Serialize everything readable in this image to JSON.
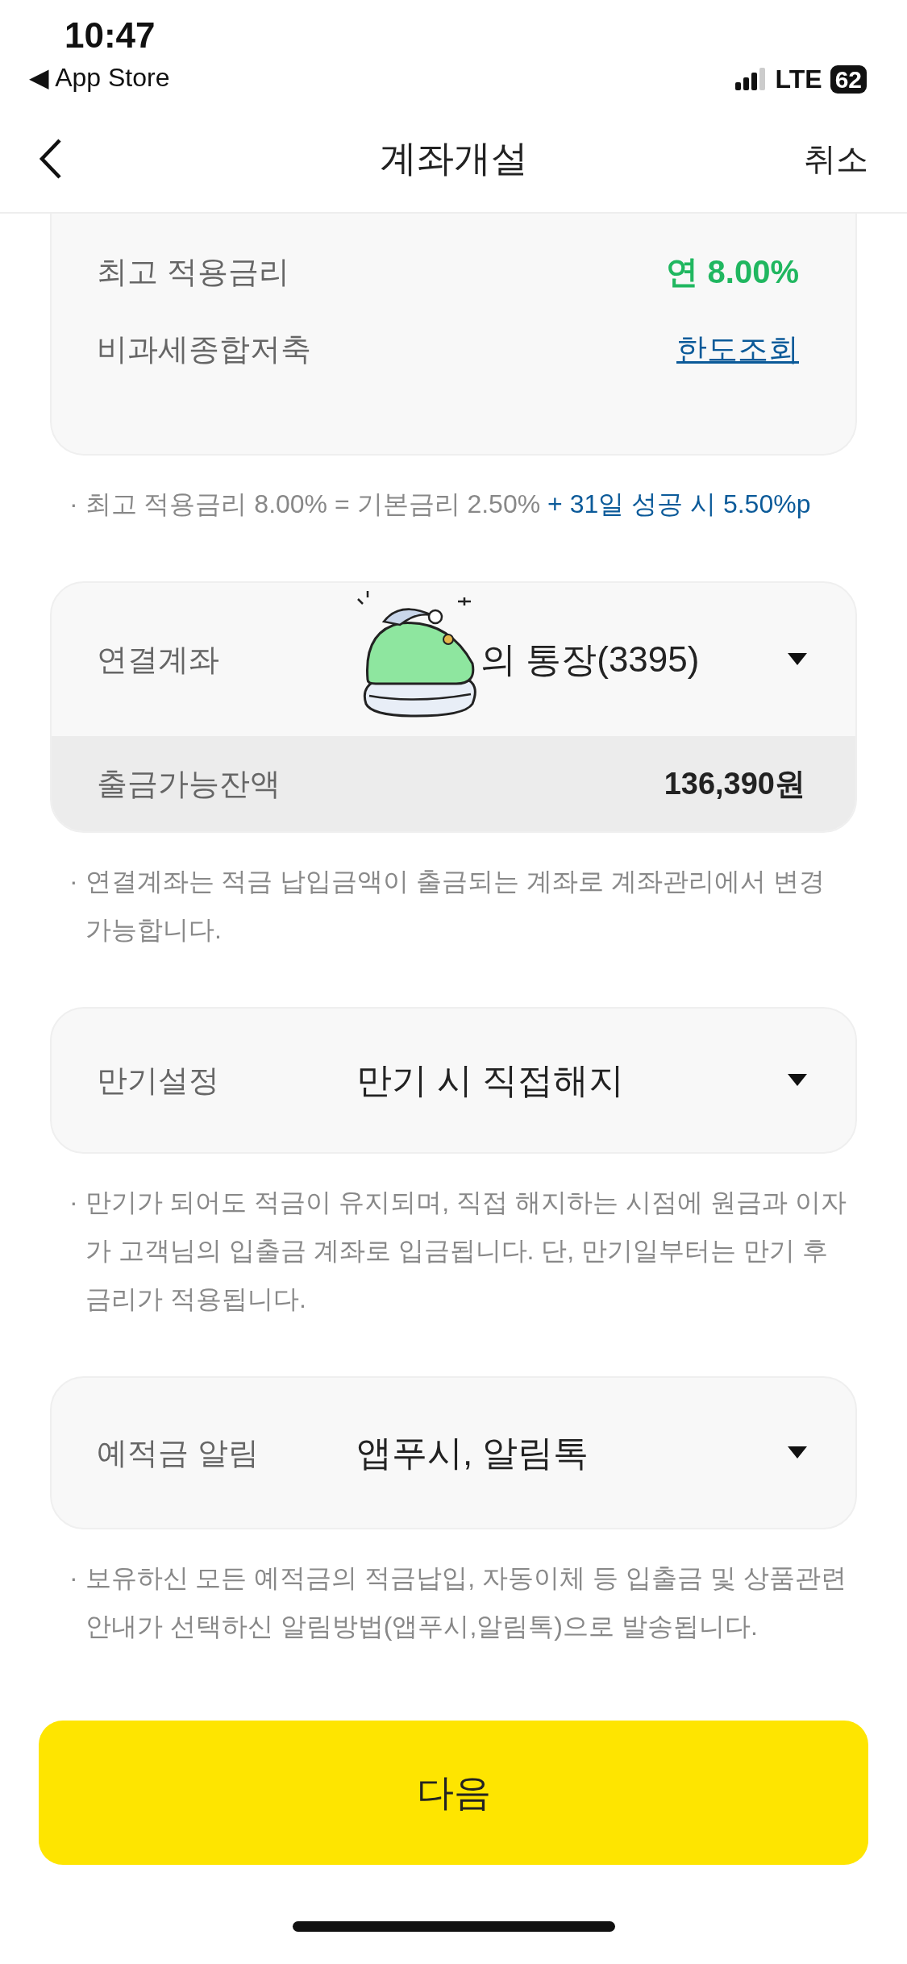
{
  "status_bar": {
    "time": "10:47",
    "back_app": "App Store",
    "back_arrow": "◀",
    "network": "LTE",
    "battery": "62"
  },
  "nav": {
    "title": "계좌개설",
    "cancel": "취소"
  },
  "rate_card": {
    "rows": [
      {
        "kind": "rate",
        "label": "최고 적용금리",
        "value": "연 8.00%"
      },
      {
        "kind": "link",
        "label": "비과세종합저축",
        "value": "한도조회"
      }
    ]
  },
  "rate_note": {
    "bullet": "·",
    "parts": [
      {
        "kind": "plain",
        "text": "최고 적용금리 8.00% = 기본금리 2.50% "
      },
      {
        "kind": "highlight",
        "text": "+ 31일 성공 시 5.50%p"
      }
    ]
  },
  "account_card": {
    "label": "연결계좌",
    "value": "의 통장(3395)",
    "balance_label": "출금가능잔액",
    "balance_value": "136,390원"
  },
  "account_note": {
    "bullet": "·",
    "parts": [
      {
        "kind": "plain",
        "text": "연결계좌는 적금 납입금액이 출금되는 계좌로 계좌관리에서 변경 가능합니다."
      }
    ]
  },
  "maturity_card": {
    "label": "만기설정",
    "value": "만기 시 직접해지"
  },
  "maturity_note": {
    "bullet": "·",
    "parts": [
      {
        "kind": "plain",
        "text": "만기가 되어도 적금이 유지되며, 직접 해지하는 시점에 원금과 이자가 고객님의 입출금 계좌로 입금됩니다. 단, 만기일부터는 만기 후 금리가 적용됩니다."
      }
    ]
  },
  "alert_card": {
    "label": "예적금 알림",
    "value": "앱푸시, 알림톡"
  },
  "alert_note": {
    "bullet": "·",
    "parts": [
      {
        "kind": "plain",
        "text": "보유하신 모든 예적금의 적금납입, 자동이체 등 입출금 및 상품관련 안내가 선택하신 알림방법(앱푸시,알림톡)으로 발송됩니다."
      }
    ]
  },
  "next_button": "다음"
}
